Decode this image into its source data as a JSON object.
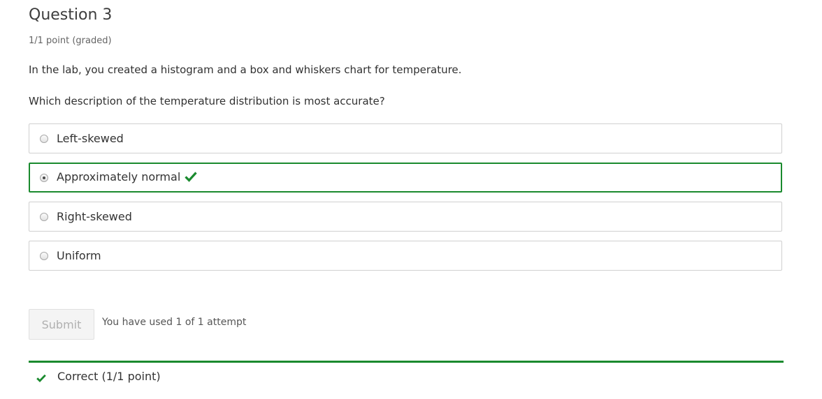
{
  "question": {
    "title": "Question 3",
    "points": "1/1 point (graded)",
    "prompt_1": "In the lab, you created a histogram and a box and whiskers chart for temperature.",
    "prompt_2": "Which description of the temperature distribution is most accurate?"
  },
  "choices": [
    {
      "label": "Left-skewed",
      "selected": false
    },
    {
      "label": "Approximately normal",
      "selected": true,
      "status": "correct",
      "status_icon": "checkmark-icon"
    },
    {
      "label": "Right-skewed",
      "selected": false
    },
    {
      "label": "Uniform",
      "selected": false
    }
  ],
  "actions": {
    "submit_label": "Submit",
    "submit_disabled": true,
    "attempts_text": "You have used 1 of 1 attempt"
  },
  "result": {
    "icon": "checkmark-icon",
    "text": "Correct (1/1 point)"
  },
  "colors": {
    "correct": "#1a8a2e",
    "border": "#d0d0d0",
    "text": "#333333",
    "muted": "#646464"
  }
}
